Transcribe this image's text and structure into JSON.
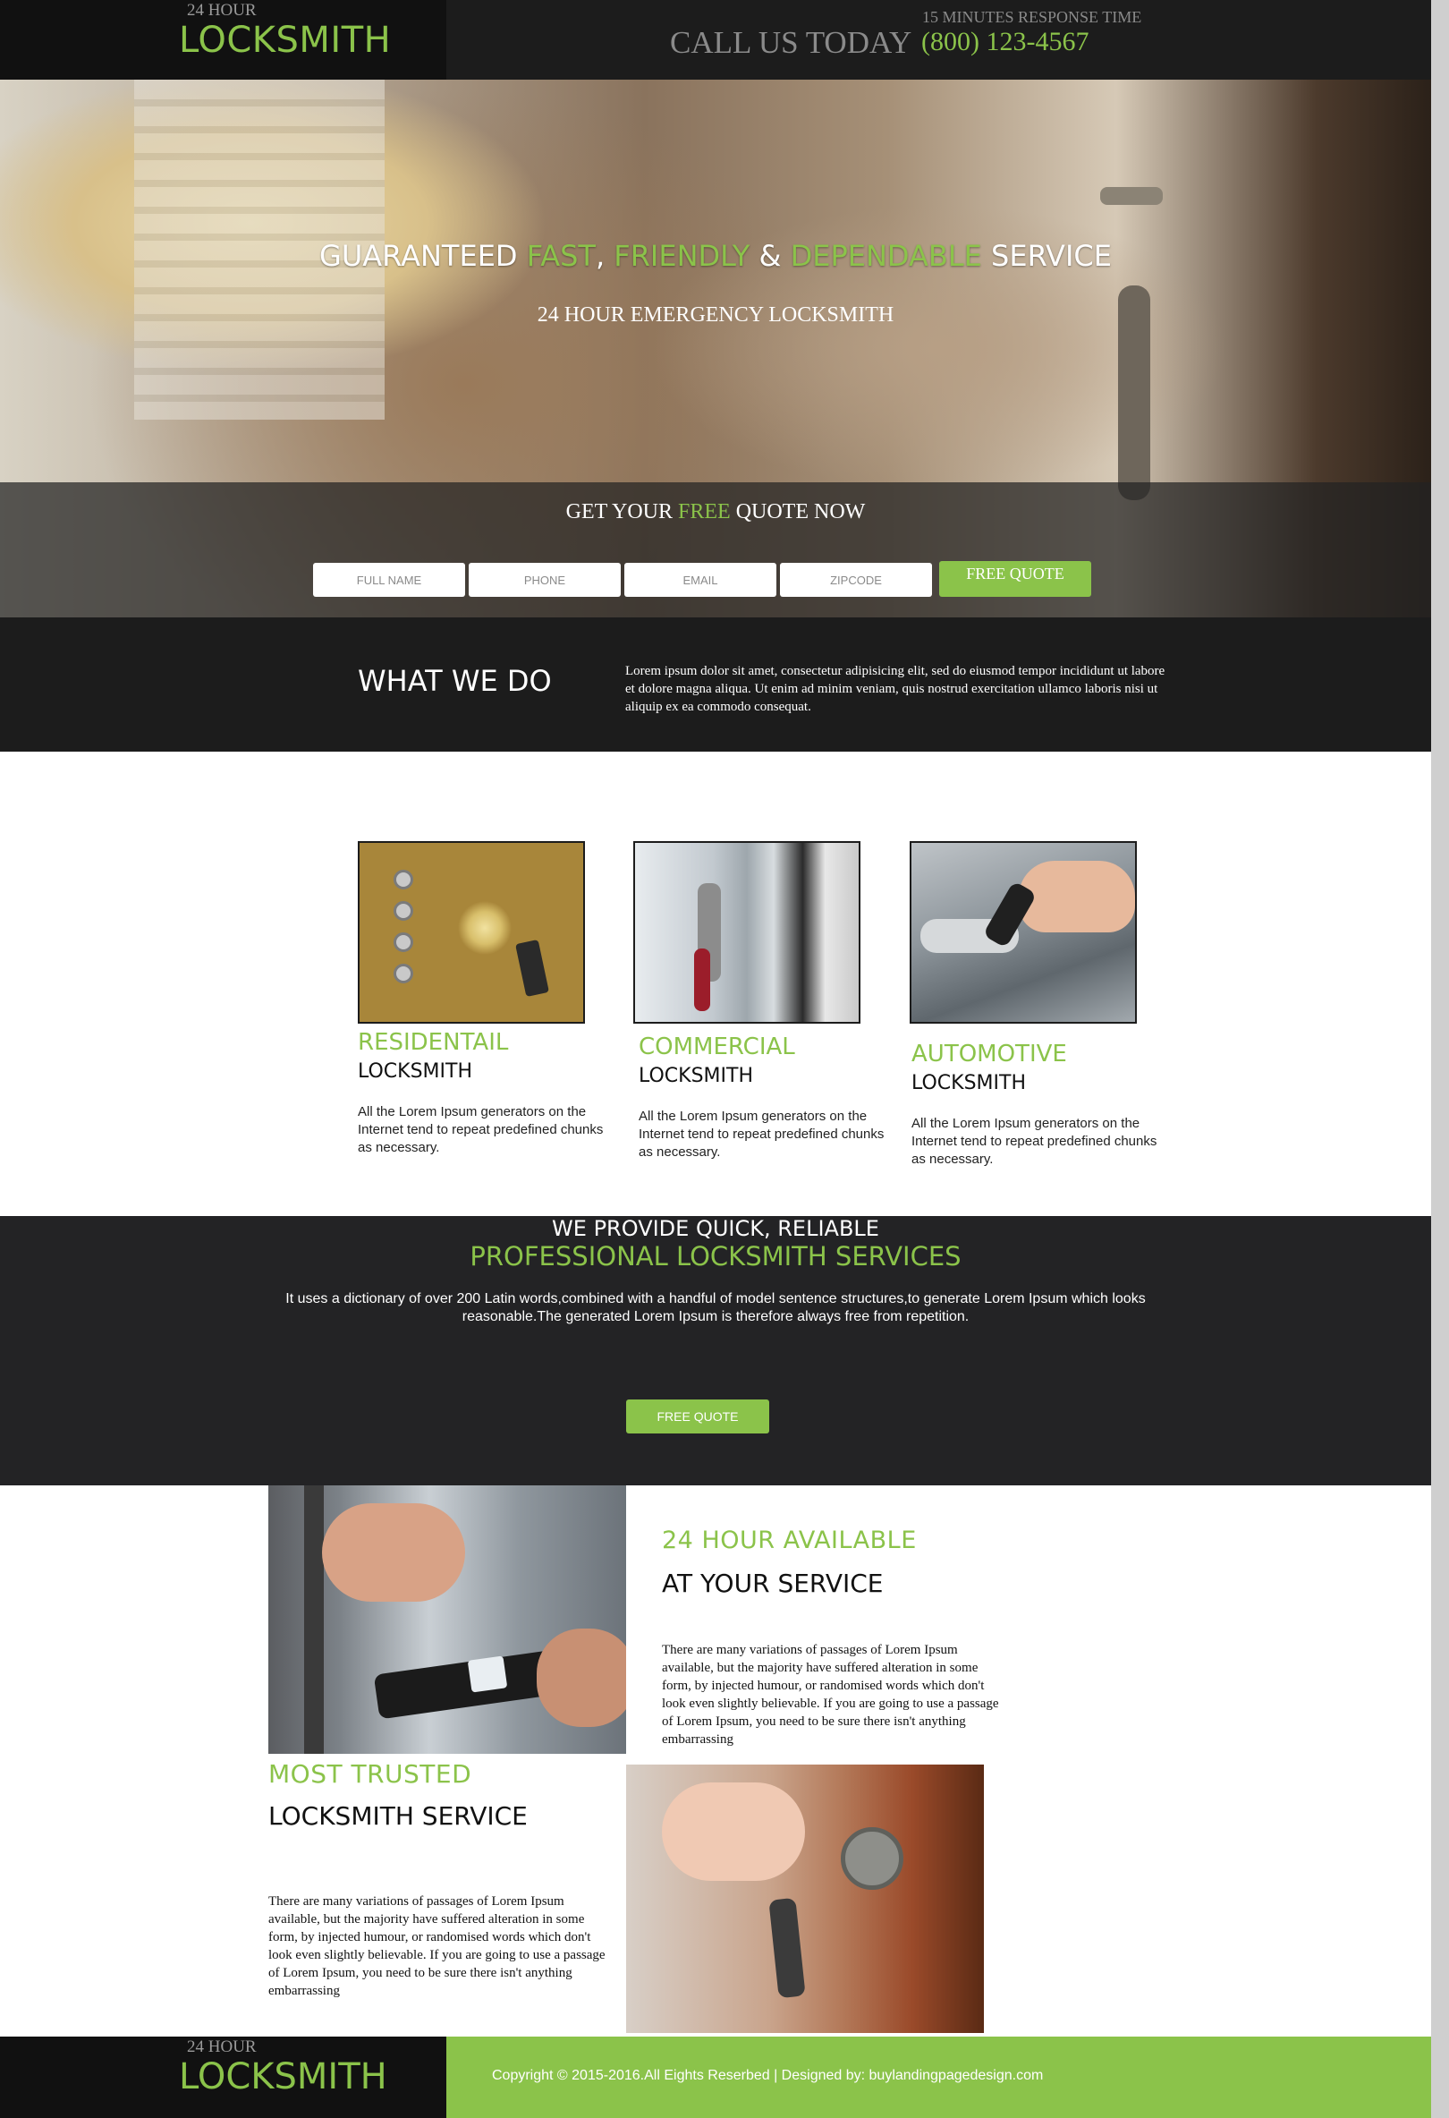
{
  "header": {
    "logo_top": "24 HOUR",
    "logo_main": "LOCKSMITH",
    "response_time": "15 MINUTES RESPONSE TIME",
    "call_label": "CALL US TODAY",
    "phone": "(800) 123-4567"
  },
  "hero": {
    "headline": {
      "w1": "GUARANTEED ",
      "w2": "FAST",
      "w3": ", ",
      "w4": "FRIENDLY",
      "w5": " & ",
      "w6": "DEPENDABLE",
      "w7": " SERVICE"
    },
    "subheadline": "24 HOUR EMERGENCY LOCKSMITH",
    "quote_title": {
      "a": "GET YOUR ",
      "b": "FREE",
      "c": " QUOTE NOW"
    },
    "form": {
      "full_name_placeholder": "FULL NAME",
      "phone_placeholder": "PHONE",
      "email_placeholder": "EMAIL",
      "zipcode_placeholder": "ZIPCODE",
      "submit_label": "FREE QUOTE"
    }
  },
  "what_we_do": {
    "title": "WHAT WE DO",
    "text": "Lorem ipsum dolor sit amet, consectetur adipisicing elit, sed do eiusmod tempor incididunt ut labore et dolore magna aliqua. Ut enim ad minim veniam, quis nostrud exercitation ullamco laboris nisi ut aliquip ex ea commodo consequat."
  },
  "services": [
    {
      "title": "RESIDENTAIL",
      "subtitle": "LOCKSMITH",
      "desc": "All the Lorem Ipsum generators on the Internet tend to repeat predefined chunks as necessary."
    },
    {
      "title": "COMMERCIAL",
      "subtitle": "LOCKSMITH",
      "desc": "All the Lorem Ipsum generators on the Internet tend to repeat predefined chunks as necessary."
    },
    {
      "title": "AUTOMOTIVE",
      "subtitle": "LOCKSMITH",
      "desc": "All the Lorem Ipsum generators on the Internet tend to repeat predefined chunks as necessary."
    }
  ],
  "professional": {
    "line1": "WE PROVIDE QUICK, RELIABLE",
    "line2": "PROFESSIONAL LOCKSMITH SERVICES",
    "text": "It uses a dictionary of over 200 Latin words,combined with a handful of model sentence structures,to generate Lorem Ipsum which looks reasonable.The generated Lorem Ipsum is therefore always free from repetition.",
    "button_label": "FREE QUOTE"
  },
  "available": {
    "title": "24 HOUR AVAILABLE",
    "subtitle": "AT YOUR SERVICE",
    "text": "There are many variations of passages of Lorem Ipsum available, but the majority have suffered alteration in some form, by injected humour, or randomised words which don't look even slightly believable. If you are going to use a passage of Lorem Ipsum, you need to be sure there isn't anything embarrassing"
  },
  "trusted": {
    "title": "MOST TRUSTED",
    "subtitle": "LOCKSMITH SERVICE",
    "text": "There are many variations of passages of Lorem Ipsum available, but the majority have suffered alteration in some form, by injected humour, or randomised words which don't look even slightly believable. If you are going to use a passage of Lorem Ipsum, you need to be sure there isn't anything embarrassing"
  },
  "footer": {
    "logo_top": "24 HOUR",
    "logo_main": "LOCKSMITH",
    "copyright": "Copyright © 2015-2016.All Eights Reserbed | Designed by: buylandingpagedesign.com"
  },
  "colors": {
    "accent": "#8bc34a",
    "dark": "#1c1c1c",
    "band": "#232325"
  }
}
